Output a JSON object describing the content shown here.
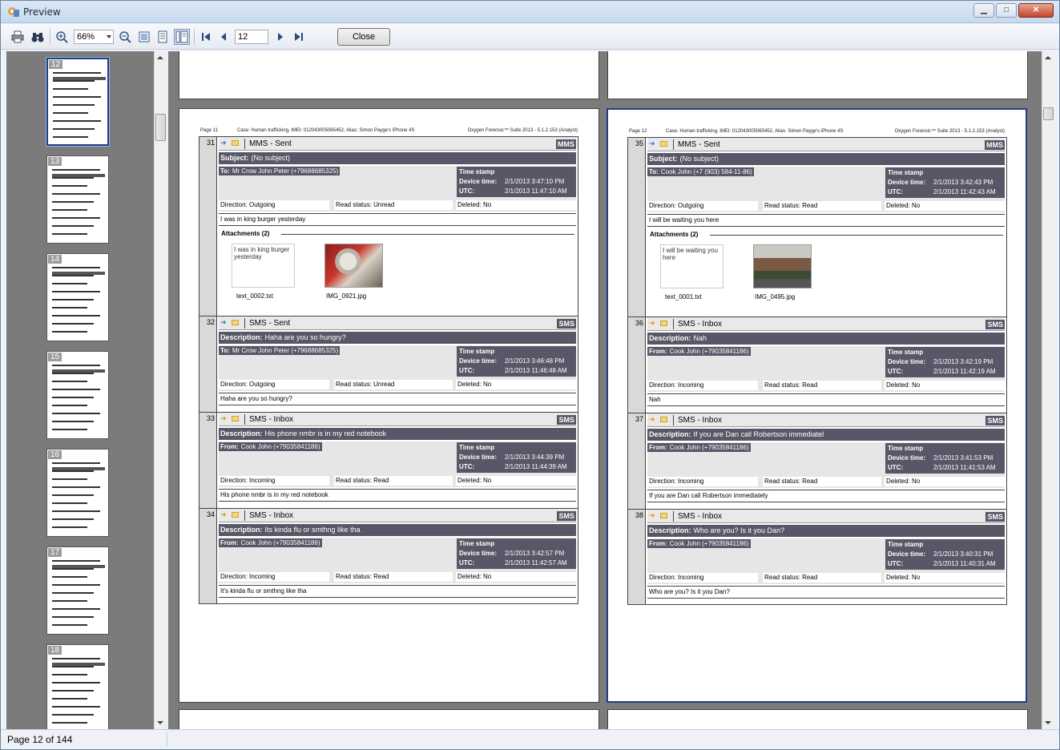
{
  "window": {
    "title": "Preview"
  },
  "toolbar": {
    "zoom_value": "66%",
    "page_value": "12",
    "close_label": "Close"
  },
  "thumbnails": [
    {
      "num": "12",
      "selected": true
    },
    {
      "num": "13"
    },
    {
      "num": "14"
    },
    {
      "num": "15"
    },
    {
      "num": "16"
    },
    {
      "num": "17"
    },
    {
      "num": "18"
    }
  ],
  "status": {
    "text": "Page 12 of 144"
  },
  "pages": [
    {
      "header": {
        "page": "Page  11",
        "case": "Case: Human trafficking, IMEI: 012043005065452, Alias: Simon Payge's iPhone 4S",
        "suite": "Oxygen Forensic™ Suite 2013 - 5.1.2.153 (Analyst)"
      },
      "records": [
        {
          "num": "31",
          "title": "MMS - Sent",
          "badge": "MMS",
          "desc_label": "Subject:",
          "desc": "(No subject)",
          "party_label": "To:",
          "party": "Mr Crow John Peter (+79688685325)",
          "ts_title": "Time stamp",
          "device_label": "Device time:",
          "device": "2/1/2013 3:47:10 PM",
          "utc_label": "UTC:",
          "utc": "2/1/2013 11:47:10 AM",
          "direction": "Direction: Outgoing",
          "read": "Read status: Unread",
          "deleted": "Deleted: No",
          "body": "I was in king burger yesterday",
          "attach_title": "Attachments (2)",
          "attach_text": "I was in king burger yesterday",
          "attach_file1": "text_0002.txt",
          "attach_file2": "IMG_0921.jpg"
        },
        {
          "num": "32",
          "title": "SMS - Sent",
          "badge": "SMS",
          "desc_label": "Description:",
          "desc": "Haha are you so hungry?",
          "party_label": "To:",
          "party": "Mr Crow John Peter (+79688685325)",
          "ts_title": "Time stamp",
          "device_label": "Device time:",
          "device": "2/1/2013 3:46:48 PM",
          "utc_label": "UTC:",
          "utc": "2/1/2013 11:46:48 AM",
          "direction": "Direction: Outgoing",
          "read": "Read status: Unread",
          "deleted": "Deleted: No",
          "body": "Haha are you so hungry?"
        },
        {
          "num": "33",
          "title": "SMS - Inbox",
          "badge": "SMS",
          "desc_label": "Description:",
          "desc": "His phone nmbr is in my red notebook",
          "party_label": "From:",
          "party": "Cook John (+79035841186)",
          "ts_title": "Time stamp",
          "device_label": "Device time:",
          "device": "2/1/2013 3:44:39 PM",
          "utc_label": "UTC:",
          "utc": "2/1/2013 11:44:39 AM",
          "direction": "Direction: Incoming",
          "read": "Read status: Read",
          "deleted": "Deleted: No",
          "body": "His phone nmbr is in my red notebook"
        },
        {
          "num": "34",
          "title": "SMS - Inbox",
          "badge": "SMS",
          "desc_label": "Description:",
          "desc": "Its kinda flu or smthng like tha",
          "party_label": "From:",
          "party": "Cook John (+79035841186)",
          "ts_title": "Time stamp",
          "device_label": "Device time:",
          "device": "2/1/2013 3:42:57 PM",
          "utc_label": "UTC:",
          "utc": "2/1/2013 11:42:57 AM",
          "direction": "Direction: Incoming",
          "read": "Read status: Read",
          "deleted": "Deleted: No",
          "body": "It's kinda flu or smthng like tha"
        }
      ]
    },
    {
      "header": {
        "page": "Page  12",
        "case": "Case: Human trafficking, IMEI: 012043005065452, Alias: Simon Payge's iPhone 4S",
        "suite": "Oxygen Forensic™ Suite 2013 - 5.1.2.153 (Analyst)"
      },
      "records": [
        {
          "num": "35",
          "title": "MMS - Sent",
          "badge": "MMS",
          "desc_label": "Subject:",
          "desc": "(No subject)",
          "party_label": "To:",
          "party": "Cook John (+7 (903) 584-11-86)",
          "ts_title": "Time stamp",
          "device_label": "Device time:",
          "device": "2/1/2013 3:42:43 PM",
          "utc_label": "UTC:",
          "utc": "2/1/2013 11:42:43 AM",
          "direction": "Direction: Outgoing",
          "read": "Read status: Read",
          "deleted": "Deleted: No",
          "body": "I will be waiting you here",
          "attach_title": "Attachments (2)",
          "attach_text": "I will be waiting you here",
          "attach_file1": "text_0001.txt",
          "attach_file2": "IMG_0495.jpg"
        },
        {
          "num": "36",
          "title": "SMS - Inbox",
          "badge": "SMS",
          "desc_label": "Description:",
          "desc": "Nah",
          "party_label": "From:",
          "party": "Cook John (+79035841186)",
          "ts_title": "Time stamp",
          "device_label": "Device time:",
          "device": "2/1/2013 3:42:19 PM",
          "utc_label": "UTC:",
          "utc": "2/1/2013 11:42:19 AM",
          "direction": "Direction: Incoming",
          "read": "Read status: Read",
          "deleted": "Deleted: No",
          "body": "Nah"
        },
        {
          "num": "37",
          "title": "SMS - Inbox",
          "badge": "SMS",
          "desc_label": "Description:",
          "desc": "If you are Dan call Robertson immediatel",
          "party_label": "From:",
          "party": "Cook John (+79035841186)",
          "ts_title": "Time stamp",
          "device_label": "Device time:",
          "device": "2/1/2013 3:41:53 PM",
          "utc_label": "UTC:",
          "utc": "2/1/2013 11:41:53 AM",
          "direction": "Direction: Incoming",
          "read": "Read status: Read",
          "deleted": "Deleted: No",
          "body": "If you are Dan call Robertson immediately"
        },
        {
          "num": "38",
          "title": "SMS - Inbox",
          "badge": "SMS",
          "desc_label": "Description:",
          "desc": "Who are you? Is it you Dan?",
          "party_label": "From:",
          "party": "Cook John (+79035841186)",
          "ts_title": "Time stamp",
          "device_label": "Device time:",
          "device": "2/1/2013 3:40:31 PM",
          "utc_label": "UTC:",
          "utc": "2/1/2013 11:40:31 AM",
          "direction": "Direction: Incoming",
          "read": "Read status: Read",
          "deleted": "Deleted: No",
          "body": "Who are you? Is it you Dan?"
        }
      ]
    }
  ]
}
